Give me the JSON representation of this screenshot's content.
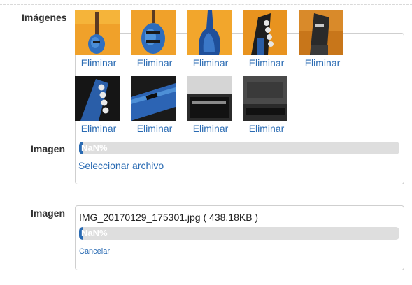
{
  "images_section": {
    "label": "Imágenes",
    "thumbnails": [
      {
        "name": "guitar-front",
        "delete_label": "Eliminar"
      },
      {
        "name": "guitar-body-angle",
        "delete_label": "Eliminar"
      },
      {
        "name": "guitar-back",
        "delete_label": "Eliminar"
      },
      {
        "name": "guitar-headstock-front",
        "delete_label": "Eliminar"
      },
      {
        "name": "guitar-headstock-logo",
        "delete_label": "Eliminar"
      },
      {
        "name": "guitar-headstock-side",
        "delete_label": "Eliminar"
      },
      {
        "name": "guitar-neck-pickups",
        "delete_label": "Eliminar"
      },
      {
        "name": "guitar-case-open",
        "delete_label": "Eliminar"
      },
      {
        "name": "guitar-case-closed",
        "delete_label": "Eliminar"
      }
    ],
    "upload_label": "Imagen",
    "progress_text": "NaN%",
    "select_file_label": "Seleccionar archivo"
  },
  "image_section": {
    "label": "Imagen",
    "file_name": "IMG_20170129_175301.jpg ( 438.18KB )",
    "progress_text": "NaN%",
    "cancel_label": "Cancelar"
  },
  "colors": {
    "link": "#2a6bb3",
    "progress_track": "#dedede",
    "progress_fill": "#2a6bb3"
  }
}
